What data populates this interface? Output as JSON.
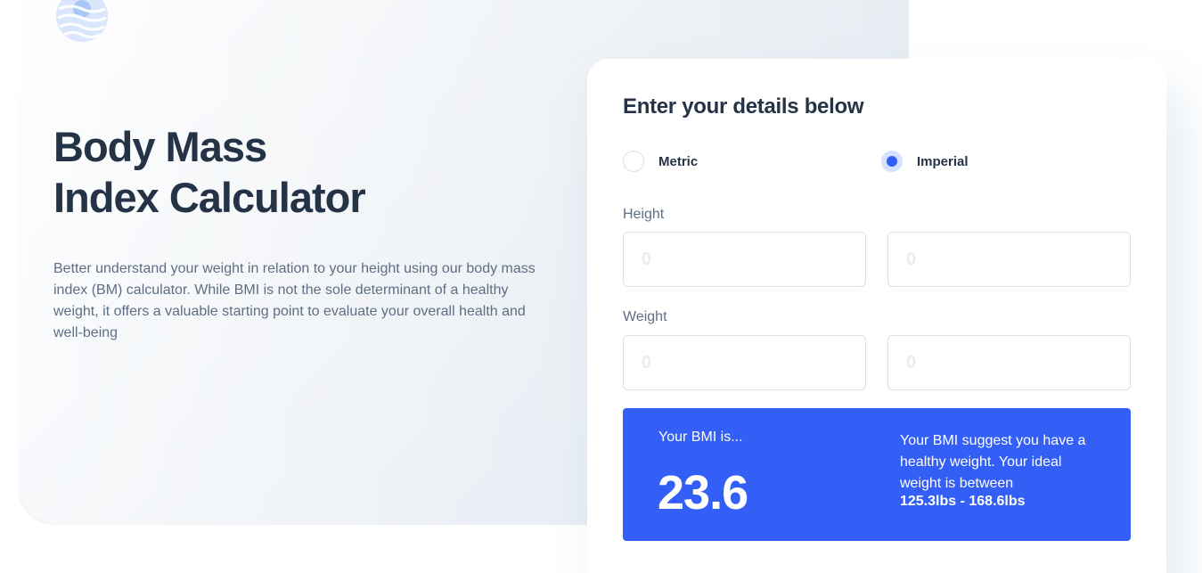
{
  "hero": {
    "title_line1": "Body Mass",
    "title_line2": "Index Calculator",
    "intro": "Better understand your weight in relation to your height using our body mass index (BM) calculator. While BMI is not the sole determinant of a healthy weight, it offers a valuable starting point to evaluate your overall health and well-being"
  },
  "form": {
    "title": "Enter your details below",
    "unit_options": [
      {
        "label": "Metric",
        "checked": false
      },
      {
        "label": "Imperial",
        "checked": true
      }
    ],
    "height_label": "Height",
    "weight_label": "Weight",
    "height_fields": [
      {
        "placeholder": "0"
      },
      {
        "placeholder": "0"
      }
    ],
    "weight_fields": [
      {
        "placeholder": "0"
      },
      {
        "placeholder": "0"
      }
    ]
  },
  "result": {
    "label": "Your BMI is...",
    "value": "23.6",
    "message": "Your BMI suggest you have a healthy weight. Your ideal weight is between",
    "range": "125.3lbs - 168.6lbs"
  },
  "colors": {
    "primary": "#345ff6",
    "heading": "#253347",
    "body_text": "#5e6e85",
    "border": "#d8e2e7"
  },
  "icons": {
    "logo": "logo-icon"
  }
}
